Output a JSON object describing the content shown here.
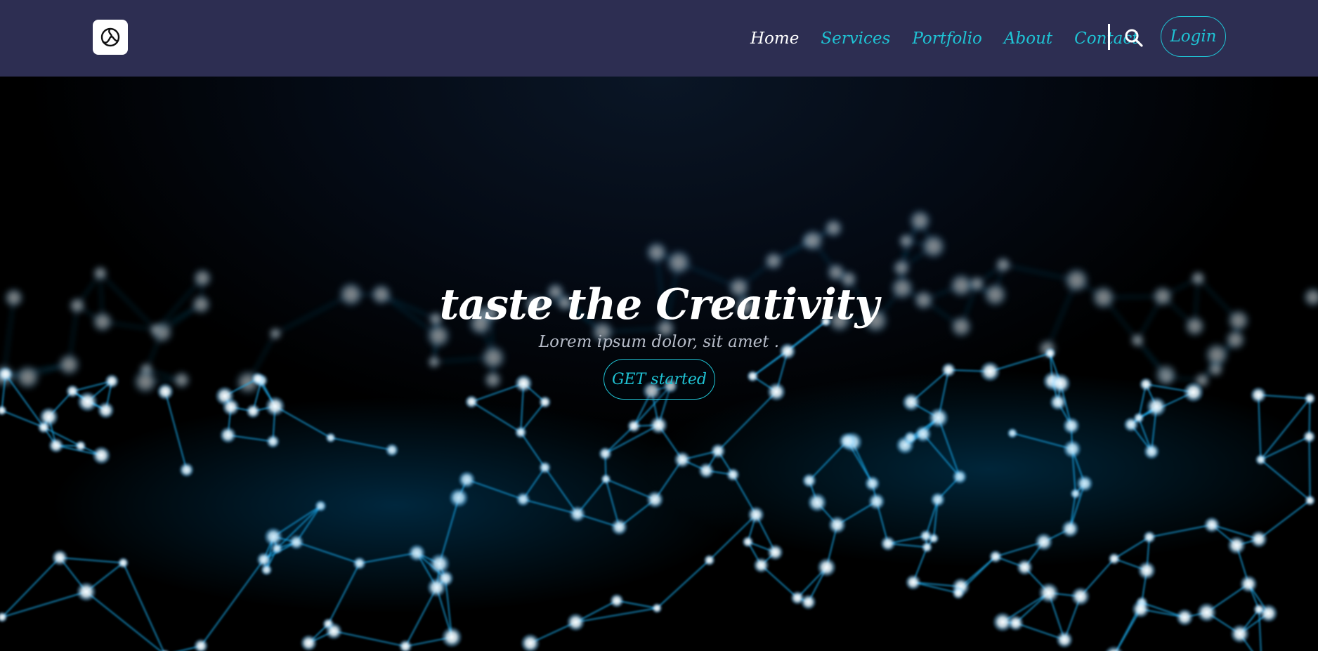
{
  "nav": {
    "logo_icon": "swirl-logo-icon",
    "links": [
      {
        "label": "Home",
        "active": true
      },
      {
        "label": "Services",
        "active": false
      },
      {
        "label": "Portfolio",
        "active": false
      },
      {
        "label": "About",
        "active": false
      },
      {
        "label": "Contact",
        "active": false
      }
    ],
    "search_icon": "search-icon",
    "login_label": "Login"
  },
  "hero": {
    "title": "taste the Creativity",
    "subtitle": "Lorem ipsum dolor, sit amet .",
    "cta_label": "GET started",
    "background": "blue-network-mesh"
  },
  "colors": {
    "navbar_bg": "#2d2e52",
    "accent": "#1fc3d4",
    "active_link": "#ffffff",
    "hero_bg": "#000000",
    "mesh_blue": "#1aa7e6"
  }
}
